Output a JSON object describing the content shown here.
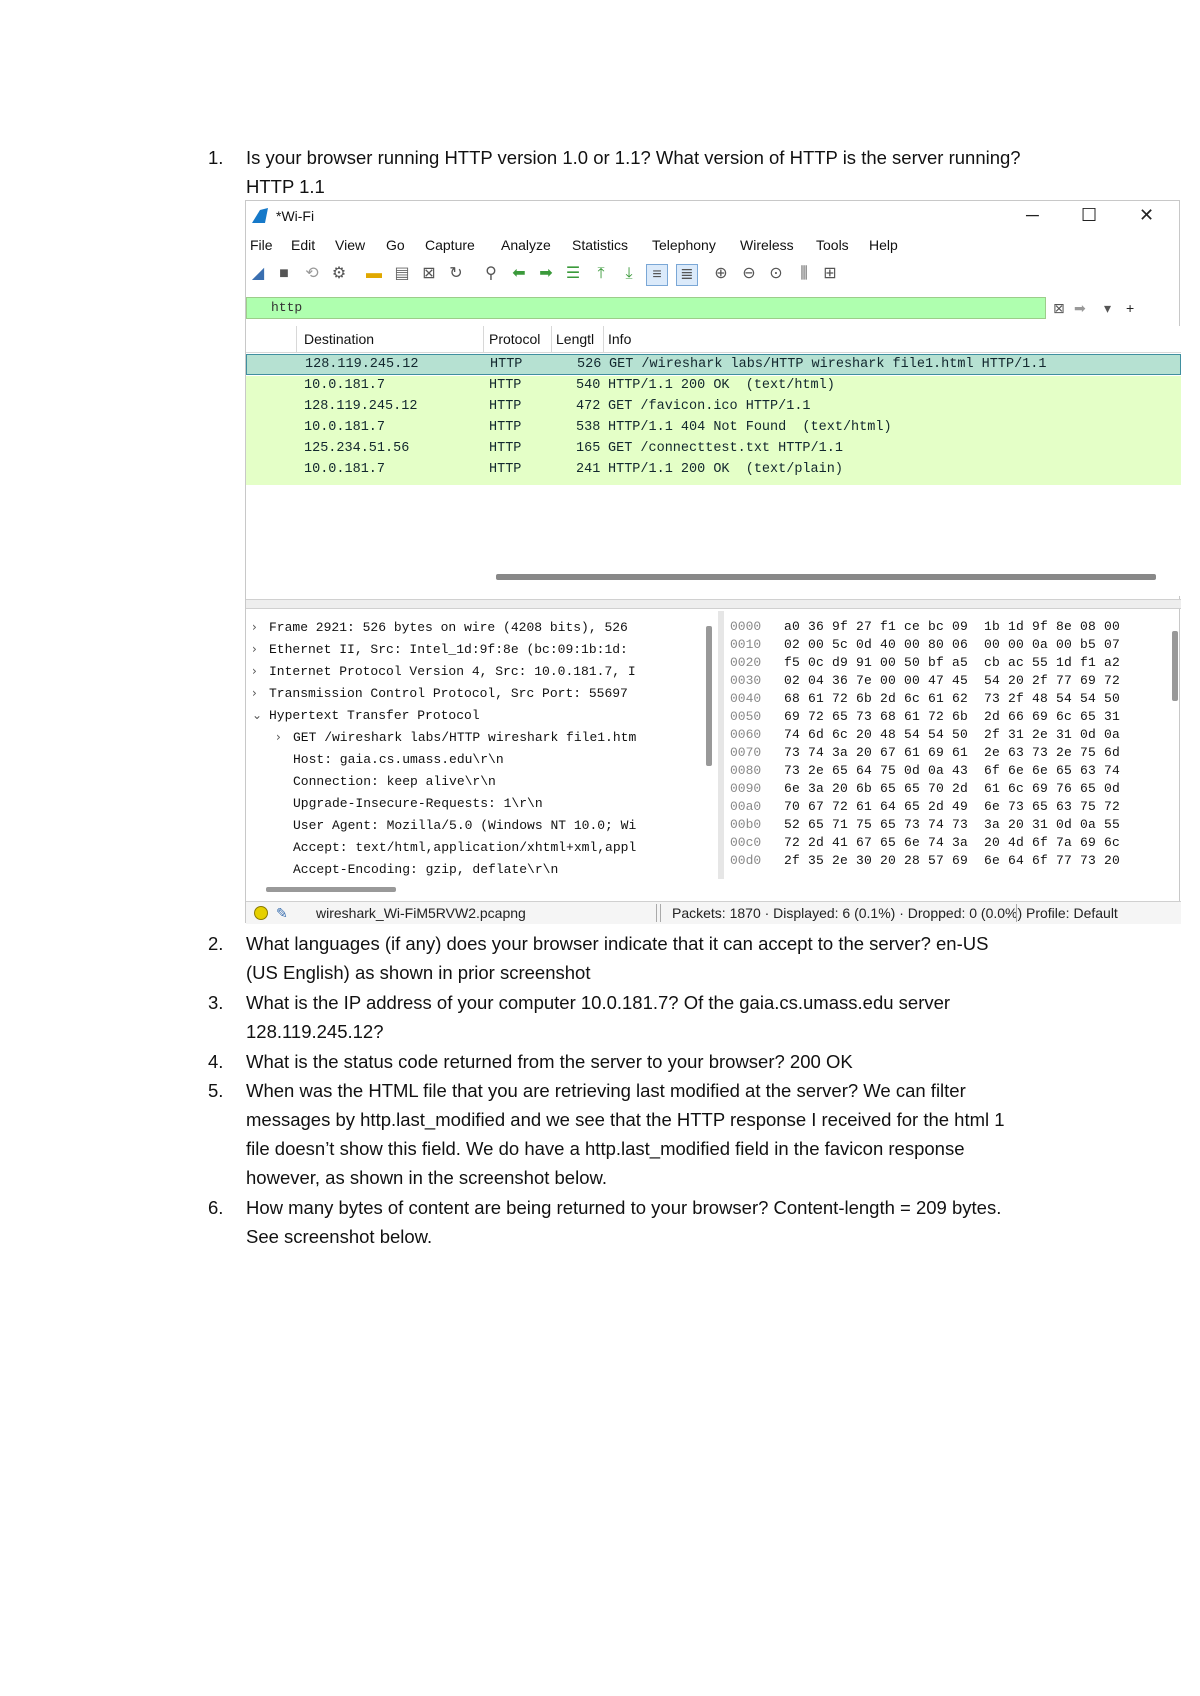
{
  "questions": [
    {
      "num": "1.",
      "lines": [
        "Is your browser running HTTP version 1.0 or 1.1? What version of HTTP is the server running?",
        "HTTP 1.1"
      ]
    },
    {
      "num": "2.",
      "lines": [
        "What languages (if any) does your browser indicate that it can accept to the server? en-US",
        "(US English) as shown in prior screenshot"
      ]
    },
    {
      "num": "3.",
      "lines": [
        "What is the IP address of your computer 10.0.181.7? Of the gaia.cs.umass.edu server",
        "128.119.245.12?"
      ]
    },
    {
      "num": "4.",
      "lines": [
        "What is the status code returned from the server to your browser? 200 OK"
      ]
    },
    {
      "num": "5.",
      "lines": [
        "When was the HTML file that you are retrieving last modified at the server? We can filter",
        "messages by http.last_modified and we see that the HTTP response I received for the html 1",
        "file doesn’t show this field. We do have a http.last_modified field in the favicon response",
        "however, as shown in the screenshot below."
      ]
    },
    {
      "num": "6.",
      "lines": [
        "How many bytes of content are being returned to your browser? Content-length = 209 bytes.",
        "See screenshot below."
      ]
    }
  ],
  "wireshark": {
    "title": "*Wi-Fi",
    "menu": [
      "File",
      "Edit",
      "View",
      "Go",
      "Capture",
      "Analyze",
      "Statistics",
      "Telephony",
      "Wireless",
      "Tools",
      "Help"
    ],
    "filter": "http",
    "columns": [
      "Destination",
      "Protocol",
      "Lengtl",
      "Info"
    ],
    "packets": [
      {
        "dest": "128.119.245.12",
        "proto": "HTTP",
        "len": "526",
        "info": "GET /wireshark labs/HTTP wireshark file1.html HTTP/1.1"
      },
      {
        "dest": "10.0.181.7",
        "proto": "HTTP",
        "len": "540",
        "info": "HTTP/1.1 200 OK  (text/html)"
      },
      {
        "dest": "128.119.245.12",
        "proto": "HTTP",
        "len": "472",
        "info": "GET /favicon.ico HTTP/1.1"
      },
      {
        "dest": "10.0.181.7",
        "proto": "HTTP",
        "len": "538",
        "info": "HTTP/1.1 404 Not Found  (text/html)"
      },
      {
        "dest": "125.234.51.56",
        "proto": "HTTP",
        "len": "165",
        "info": "GET /connecttest.txt HTTP/1.1"
      },
      {
        "dest": "10.0.181.7",
        "proto": "HTTP",
        "len": "241",
        "info": "HTTP/1.1 200 OK  (text/plain)"
      }
    ],
    "details": [
      {
        "arrow": "›",
        "indent": 0,
        "text": "Frame 2921: 526 bytes on wire (4208 bits), 526"
      },
      {
        "arrow": "›",
        "indent": 0,
        "text": "Ethernet II, Src: Intel_1d:9f:8e (bc:09:1b:1d:"
      },
      {
        "arrow": "›",
        "indent": 0,
        "text": "Internet Protocol Version 4, Src: 10.0.181.7, I"
      },
      {
        "arrow": "›",
        "indent": 0,
        "text": "Transmission Control Protocol, Src Port: 55697"
      },
      {
        "arrow": "⌄",
        "indent": 0,
        "text": "Hypertext Transfer Protocol"
      },
      {
        "arrow": "›",
        "indent": 1,
        "text": "GET /wireshark labs/HTTP wireshark file1.htm"
      },
      {
        "arrow": "",
        "indent": 1,
        "text": "Host: gaia.cs.umass.edu\\r\\n"
      },
      {
        "arrow": "",
        "indent": 1,
        "text": "Connection: keep alive\\r\\n"
      },
      {
        "arrow": "",
        "indent": 1,
        "text": "Upgrade-Insecure-Requests: 1\\r\\n"
      },
      {
        "arrow": "",
        "indent": 1,
        "text": "User Agent: Mozilla/5.0 (Windows NT 10.0; Wi"
      },
      {
        "arrow": "",
        "indent": 1,
        "text": "Accept: text/html,application/xhtml+xml,appl"
      },
      {
        "arrow": "",
        "indent": 1,
        "text": "Accept-Encoding: gzip, deflate\\r\\n"
      }
    ],
    "hex": [
      {
        "off": "0000",
        "bytes": "a0 36 9f 27 f1 ce bc 09  1b 1d 9f 8e 08 00"
      },
      {
        "off": "0010",
        "bytes": "02 00 5c 0d 40 00 80 06  00 00 0a 00 b5 07"
      },
      {
        "off": "0020",
        "bytes": "f5 0c d9 91 00 50 bf a5  cb ac 55 1d f1 a2"
      },
      {
        "off": "0030",
        "bytes": "02 04 36 7e 00 00 47 45  54 20 2f 77 69 72"
      },
      {
        "off": "0040",
        "bytes": "68 61 72 6b 2d 6c 61 62  73 2f 48 54 54 50"
      },
      {
        "off": "0050",
        "bytes": "69 72 65 73 68 61 72 6b  2d 66 69 6c 65 31"
      },
      {
        "off": "0060",
        "bytes": "74 6d 6c 20 48 54 54 50  2f 31 2e 31 0d 0a"
      },
      {
        "off": "0070",
        "bytes": "73 74 3a 20 67 61 69 61  2e 63 73 2e 75 6d"
      },
      {
        "off": "0080",
        "bytes": "73 2e 65 64 75 0d 0a 43  6f 6e 6e 65 63 74"
      },
      {
        "off": "0090",
        "bytes": "6e 3a 20 6b 65 65 70 2d  61 6c 69 76 65 0d"
      },
      {
        "off": "00a0",
        "bytes": "70 67 72 61 64 65 2d 49  6e 73 65 63 75 72"
      },
      {
        "off": "00b0",
        "bytes": "52 65 71 75 65 73 74 73  3a 20 31 0d 0a 55"
      },
      {
        "off": "00c0",
        "bytes": "72 2d 41 67 65 6e 74 3a  20 4d 6f 7a 69 6c"
      },
      {
        "off": "00d0",
        "bytes": "2f 35 2e 30 20 28 57 69  6e 64 6f 77 73 20"
      }
    ],
    "status": {
      "file": "wireshark_Wi-FiM5RVW2.pcapng",
      "packets": "Packets: 1870 · Displayed: 6 (0.1%) · Dropped: 0 (0.0%)",
      "profile": "Profile: Default"
    },
    "colors": {
      "row_bg": "#e4ffc7",
      "selected_bg": "#b6e1d2",
      "filter_bg": "#afffaf"
    }
  }
}
